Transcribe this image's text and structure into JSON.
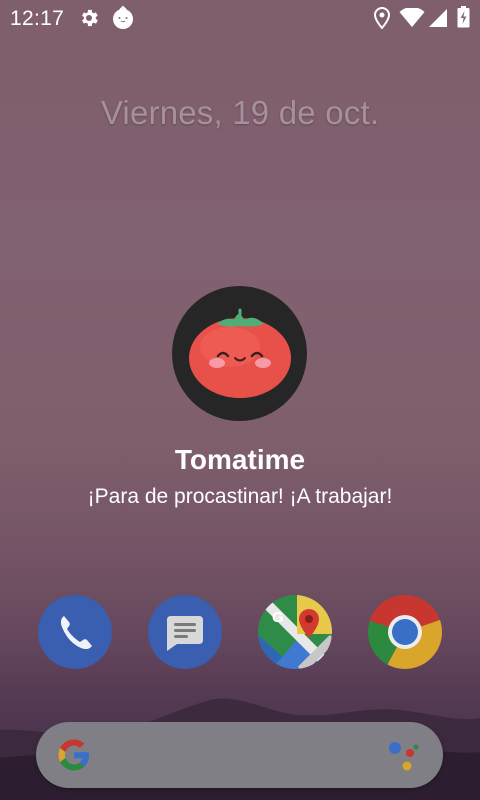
{
  "status_bar": {
    "time": "12:17",
    "left_icons": [
      "gear-icon",
      "app-notification-icon"
    ],
    "right_icons": [
      "location-icon",
      "wifi-icon",
      "cellular-signal-icon",
      "battery-icon"
    ]
  },
  "lockscreen": {
    "date": "Viernes, 19 de oct."
  },
  "app_dialog": {
    "logo_icon": "tomato-icon",
    "title": "Tomatime",
    "tagline": "¡Para de procastinar! ¡A trabajar!"
  },
  "dock": {
    "apps": [
      "phone-icon",
      "messages-icon",
      "maps-icon",
      "chrome-icon"
    ]
  },
  "search_bar": {
    "logo_icon": "google-g-icon",
    "assistant_icon": "google-assistant-icon"
  },
  "colors": {
    "wallpaper": "#8a6878",
    "logo_bg": "#262626",
    "tomato": "#e8504a",
    "leaf": "#4fae78",
    "search_bar": "#7f7f85"
  }
}
